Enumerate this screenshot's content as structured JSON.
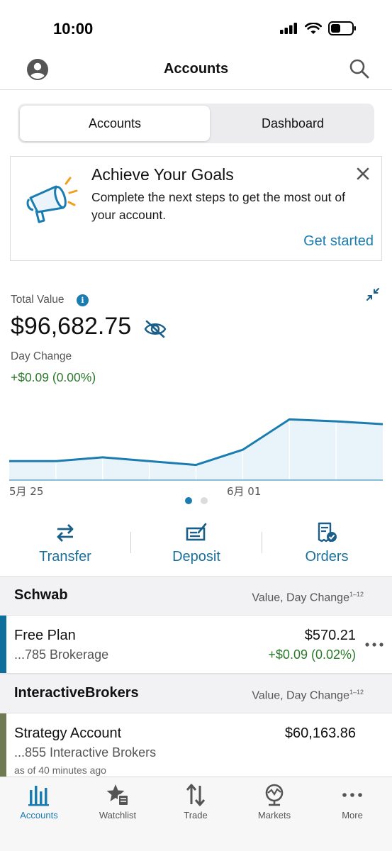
{
  "status_bar": {
    "time": "10:00"
  },
  "nav": {
    "title": "Accounts"
  },
  "segments": {
    "accounts": "Accounts",
    "dashboard": "Dashboard"
  },
  "goal_card": {
    "title": "Achieve Your Goals",
    "body": "Complete the next steps to get the most out of your account.",
    "link": "Get started"
  },
  "summary": {
    "total_label": "Total Value",
    "total_value": "$96,682.75",
    "day_label": "Day Change",
    "day_value": "+$0.09 (0.00%)"
  },
  "chart_data": {
    "type": "area",
    "x_labels": [
      "5月 25",
      "6月 01"
    ],
    "values": [
      96673,
      96673,
      96674,
      96673,
      96672,
      96676,
      96684,
      96683.5,
      96682.75
    ],
    "ylim": [
      96668,
      96688
    ],
    "series_color": "#1a7cb0",
    "fill_color": "#e8f4fa"
  },
  "actions": {
    "transfer": "Transfer",
    "deposit": "Deposit",
    "orders": "Orders"
  },
  "sections": [
    {
      "name": "Schwab",
      "meta": "Value, Day Change",
      "meta_sup": "1–12",
      "accounts": [
        {
          "name": "Free Plan",
          "sub": "...785 Brokerage",
          "value": "$570.21",
          "change": "+$0.09 (0.02%)",
          "accent": "#0d6f9a"
        }
      ]
    },
    {
      "name": "InteractiveBrokers",
      "meta": "Value, Day Change",
      "meta_sup": "1–12",
      "accounts": [
        {
          "name": "Strategy Account",
          "sub": "...855 Interactive Brokers",
          "value": "$60,163.86",
          "asof": "as of 40 minutes ago",
          "accent": "#6f7a52"
        }
      ]
    }
  ],
  "tabs": {
    "accounts": "Accounts",
    "watchlist": "Watchlist",
    "trade": "Trade",
    "markets": "Markets",
    "more": "More"
  },
  "colors": {
    "accent": "#1a7cb0",
    "positive": "#2b7a2b"
  }
}
